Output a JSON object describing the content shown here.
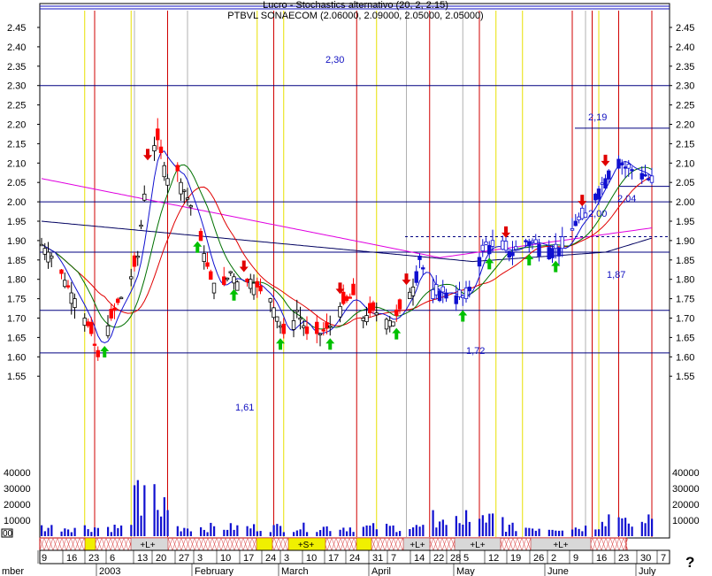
{
  "header": {
    "title": "PTBVL SONAECOM (2.06000, 2.09000, 2.05000, 2.05000)",
    "overlay_text": "Lucro - Stochastics alternativo (20, 2, 2.15)"
  },
  "help_label": "?",
  "colors": {
    "up_candle": "#ffffff",
    "down_candle": "#ff0000",
    "blue_candle": "#1010d0",
    "ma_short": "#1010d0",
    "ma_green": "#007000",
    "ma_red": "#e00000",
    "ma_black": "#000060",
    "ma_magenta": "#e000e0",
    "vline_red": "#d00000",
    "vline_yellow": "#e8e000",
    "hline": "#000080",
    "signal_up": "#00c000",
    "signal_down": "#e00000"
  },
  "chart_data": {
    "type": "candlestick",
    "title": "PTBVL SONAECOM (2.06000, 2.09000, 2.05000, 2.05000)",
    "price_axis": {
      "ylim": [
        1.5,
        2.5
      ],
      "ticks": [
        "2.45",
        "2.40",
        "2.35",
        "2.30",
        "2.25",
        "2.20",
        "2.15",
        "2.10",
        "2.05",
        "2.00",
        "1.95",
        "1.90",
        "1.85",
        "1.80",
        "1.75",
        "1.70",
        "1.65",
        "1.60",
        "1.55"
      ]
    },
    "volume_axis": {
      "ylim": [
        0,
        45000
      ],
      "ticks": [
        "40000",
        "30000",
        "20000",
        "10000"
      ],
      "left_tick": "00"
    },
    "x_date_ticks": [
      "9",
      "16",
      "23",
      "6",
      "13",
      "20",
      "27",
      "3",
      "10",
      "17",
      "24",
      "3",
      "10",
      "17",
      "24",
      "31",
      "7",
      "14",
      "22",
      "28",
      "5",
      "12",
      "19",
      "26",
      "2",
      "9",
      "16",
      "23",
      "30",
      "7"
    ],
    "x_month_labels": [
      {
        "label": "mber",
        "day": 0
      },
      {
        "label": "2003",
        "day": 26
      },
      {
        "label": "February",
        "day": 56
      },
      {
        "label": "March",
        "day": 84
      },
      {
        "label": "April",
        "day": 112
      },
      {
        "label": "May",
        "day": 142
      },
      {
        "label": "June",
        "day": 173
      },
      {
        "label": "July",
        "day": 203
      }
    ],
    "horizontal_levels": [
      {
        "value": 2.3,
        "label": "2,30"
      },
      {
        "value": 2.19,
        "label": "2,19"
      },
      {
        "value": 2.04,
        "label": "2,04"
      },
      {
        "value": 2.0,
        "label": "2,00"
      },
      {
        "value": 1.87,
        "label": "1,87"
      },
      {
        "value": 1.72,
        "label": "1,72"
      },
      {
        "value": 1.61,
        "label": "1,61"
      }
    ],
    "trend_signals": [
      {
        "label": "+L+"
      },
      {
        "label": "+S+"
      },
      {
        "label": "+L+"
      },
      {
        "label": "+L+"
      },
      {
        "label": "+L+"
      }
    ],
    "price_anchors": [
      {
        "day": 0,
        "close": 1.89
      },
      {
        "day": 4,
        "close": 1.85
      },
      {
        "day": 8,
        "close": 1.78
      },
      {
        "day": 12,
        "close": 1.72
      },
      {
        "day": 15,
        "close": 1.66
      },
      {
        "day": 17,
        "close": 1.6
      },
      {
        "day": 19,
        "close": 1.66
      },
      {
        "day": 23,
        "close": 1.74
      },
      {
        "day": 26,
        "close": 1.78
      },
      {
        "day": 29,
        "close": 1.86
      },
      {
        "day": 31,
        "close": 2.02
      },
      {
        "day": 33,
        "close": 2.13
      },
      {
        "day": 35,
        "close": 2.16
      },
      {
        "day": 38,
        "close": 2.06
      },
      {
        "day": 40,
        "close": 2.11
      },
      {
        "day": 42,
        "close": 2.05
      },
      {
        "day": 45,
        "close": 1.99
      },
      {
        "day": 48,
        "close": 1.9
      },
      {
        "day": 51,
        "close": 1.8
      },
      {
        "day": 54,
        "close": 1.77
      },
      {
        "day": 57,
        "close": 1.82
      },
      {
        "day": 60,
        "close": 1.78
      },
      {
        "day": 63,
        "close": 1.8
      },
      {
        "day": 66,
        "close": 1.77
      },
      {
        "day": 69,
        "close": 1.75
      },
      {
        "day": 72,
        "close": 1.68
      },
      {
        "day": 74,
        "close": 1.64
      },
      {
        "day": 77,
        "close": 1.72
      },
      {
        "day": 80,
        "close": 1.66
      },
      {
        "day": 84,
        "close": 1.66
      },
      {
        "day": 87,
        "close": 1.68
      },
      {
        "day": 90,
        "close": 1.73
      },
      {
        "day": 94,
        "close": 1.76
      },
      {
        "day": 97,
        "close": 1.7
      },
      {
        "day": 100,
        "close": 1.72
      },
      {
        "day": 103,
        "close": 1.7
      },
      {
        "day": 106,
        "close": 1.69
      },
      {
        "day": 109,
        "close": 1.74
      },
      {
        "day": 112,
        "close": 1.78
      },
      {
        "day": 114,
        "close": 1.86
      },
      {
        "day": 116,
        "close": 1.8
      },
      {
        "day": 118,
        "close": 1.75
      },
      {
        "day": 120,
        "close": 1.77
      },
      {
        "day": 124,
        "close": 1.76
      },
      {
        "day": 128,
        "close": 1.75
      },
      {
        "day": 131,
        "close": 1.84
      },
      {
        "day": 134,
        "close": 1.89
      },
      {
        "day": 138,
        "close": 1.88
      },
      {
        "day": 142,
        "close": 1.87
      },
      {
        "day": 146,
        "close": 1.9
      },
      {
        "day": 150,
        "close": 1.89
      },
      {
        "day": 154,
        "close": 1.88
      },
      {
        "day": 158,
        "close": 1.88
      },
      {
        "day": 161,
        "close": 1.95
      },
      {
        "day": 164,
        "close": 1.96
      },
      {
        "day": 167,
        "close": 2.02
      },
      {
        "day": 170,
        "close": 2.06
      },
      {
        "day": 173,
        "close": 2.12
      },
      {
        "day": 176,
        "close": 2.09
      },
      {
        "day": 179,
        "close": 2.08
      },
      {
        "day": 182,
        "close": 2.07
      },
      {
        "day": 184,
        "close": 2.05
      }
    ],
    "last_bar": {
      "open": 2.06,
      "high": 2.09,
      "low": 2.05,
      "close": 2.05
    }
  }
}
